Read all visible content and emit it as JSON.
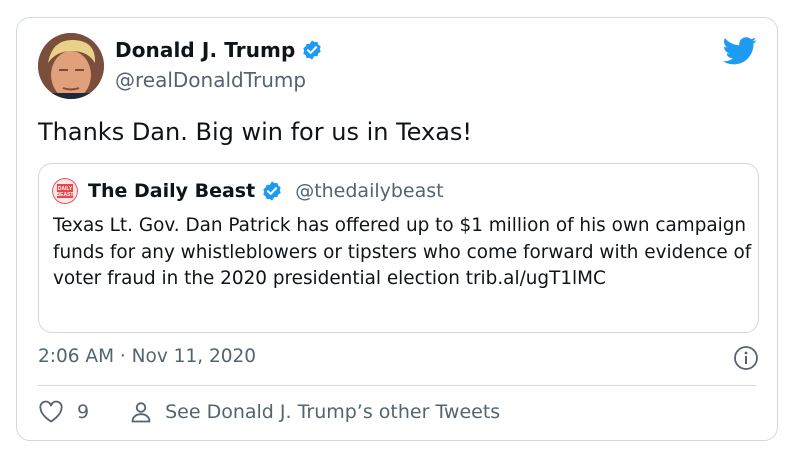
{
  "tweet": {
    "author_name": "Donald J. Trump",
    "author_handle": "@realDonaldTrump",
    "text": "Thanks Dan. Big win for us in Texas!",
    "timestamp": "2:06 AM · Nov 11, 2020",
    "like_count": "9",
    "see_other_label": "See Donald J. Trump’s other Tweets"
  },
  "quoted": {
    "author_name": "The Daily Beast",
    "author_handle": "@thedailybeast",
    "logo_text": "DAILY BEAST",
    "text": "Texas Lt. Gov. Dan Patrick has offered up to $1 million of his own campaign funds for any whistleblowers or tipsters who come forward with evidence of voter fraud in the 2020 presidential election trib.al/ugT1lMC"
  },
  "icons": {
    "verified": "verified-badge-icon",
    "brand": "twitter-bird-icon",
    "info": "info-icon",
    "like": "heart-icon",
    "profile": "person-icon"
  },
  "colors": {
    "verified_blue": "#1d9bf0",
    "secondary_text": "#536471",
    "border": "#cfd9de",
    "daily_beast_red": "#e8464a"
  }
}
